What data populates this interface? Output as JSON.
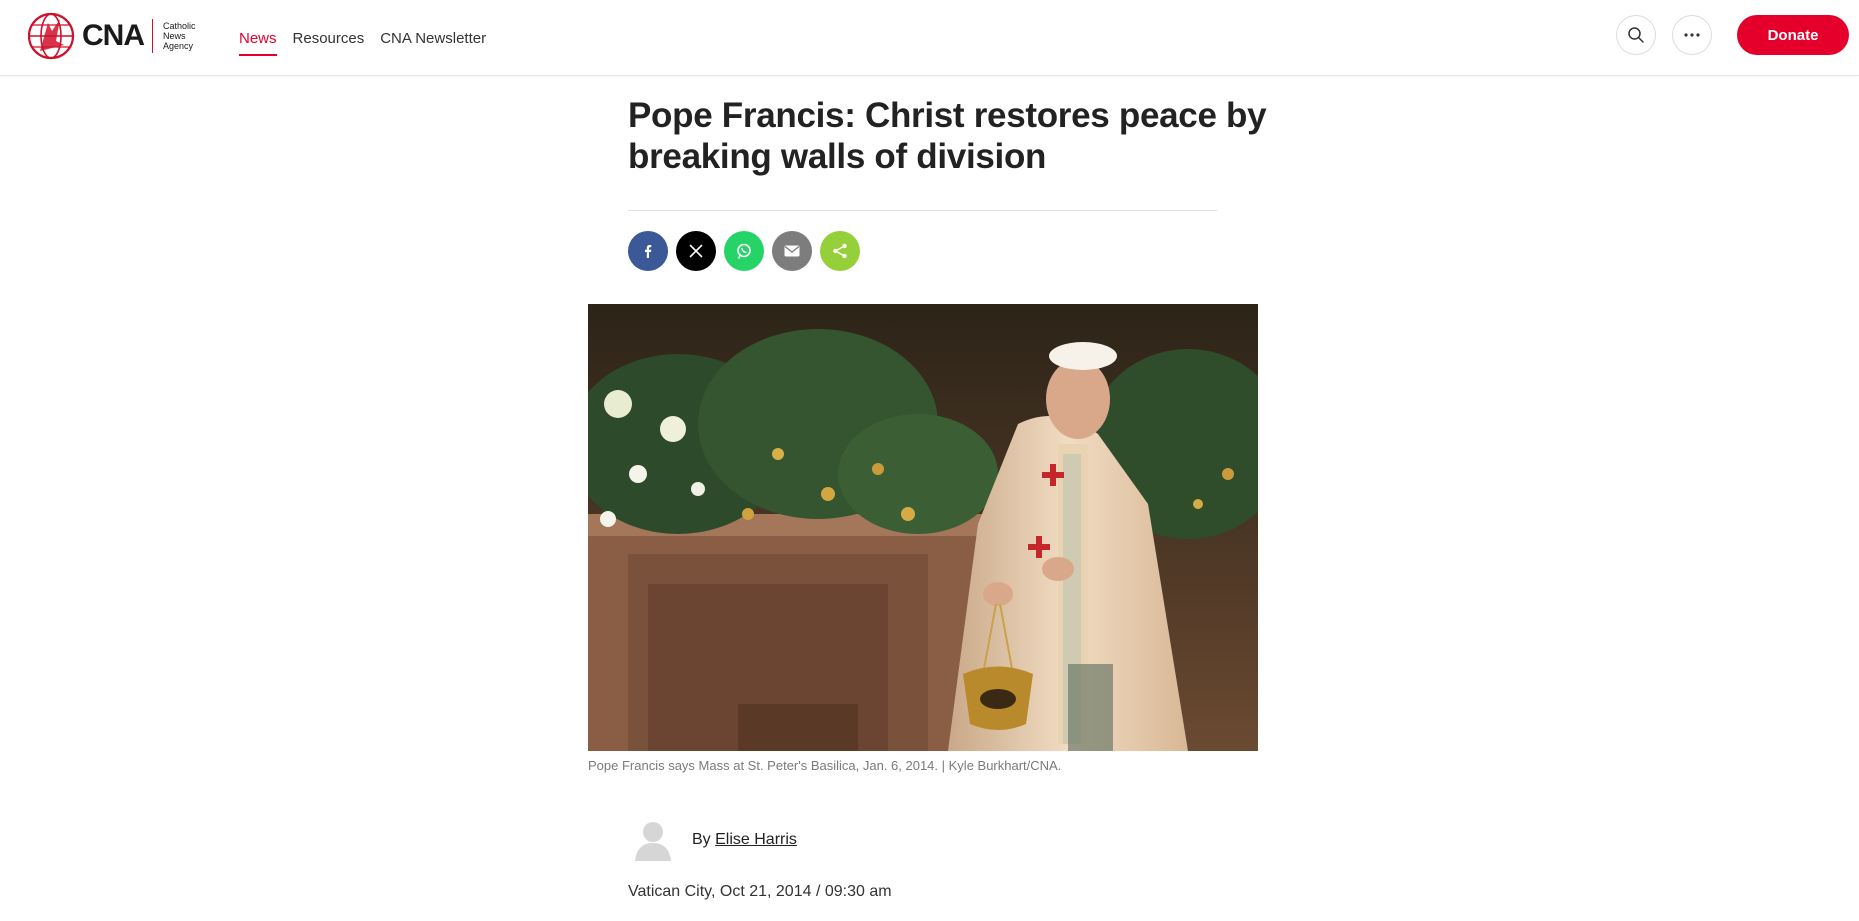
{
  "header": {
    "logo": {
      "name": "CNA",
      "tagline": [
        "Catholic",
        "News",
        "Agency"
      ]
    },
    "nav": [
      {
        "label": "News",
        "active": true
      },
      {
        "label": "Resources",
        "active": false
      },
      {
        "label": "CNA Newsletter",
        "active": false
      }
    ],
    "actions": {
      "search_icon": "search-icon",
      "more_icon": "ellipsis-icon",
      "donate_label": "Donate"
    }
  },
  "article": {
    "title": "Pope Francis: Christ restores peace by breaking walls of division",
    "share": [
      {
        "network": "facebook",
        "icon": "facebook-icon",
        "color": "#3b5998"
      },
      {
        "network": "x",
        "icon": "x-icon",
        "color": "#000000"
      },
      {
        "network": "whatsapp",
        "icon": "whatsapp-icon",
        "color": "#25d366"
      },
      {
        "network": "email",
        "icon": "email-icon",
        "color": "#7d7d7d"
      },
      {
        "network": "share",
        "icon": "share-icon",
        "color": "#95d03a"
      }
    ],
    "image_caption": "Pope Francis says Mass at St. Peter's Basilica, Jan. 6, 2014. | Kyle Burkhart/CNA.",
    "byline_prefix": "By",
    "author": "Elise Harris",
    "dateline": "Vatican City, Oct 21, 2014 / 09:30 am"
  },
  "colors": {
    "brand_red": "#e4002b",
    "text_dark": "#222222"
  }
}
